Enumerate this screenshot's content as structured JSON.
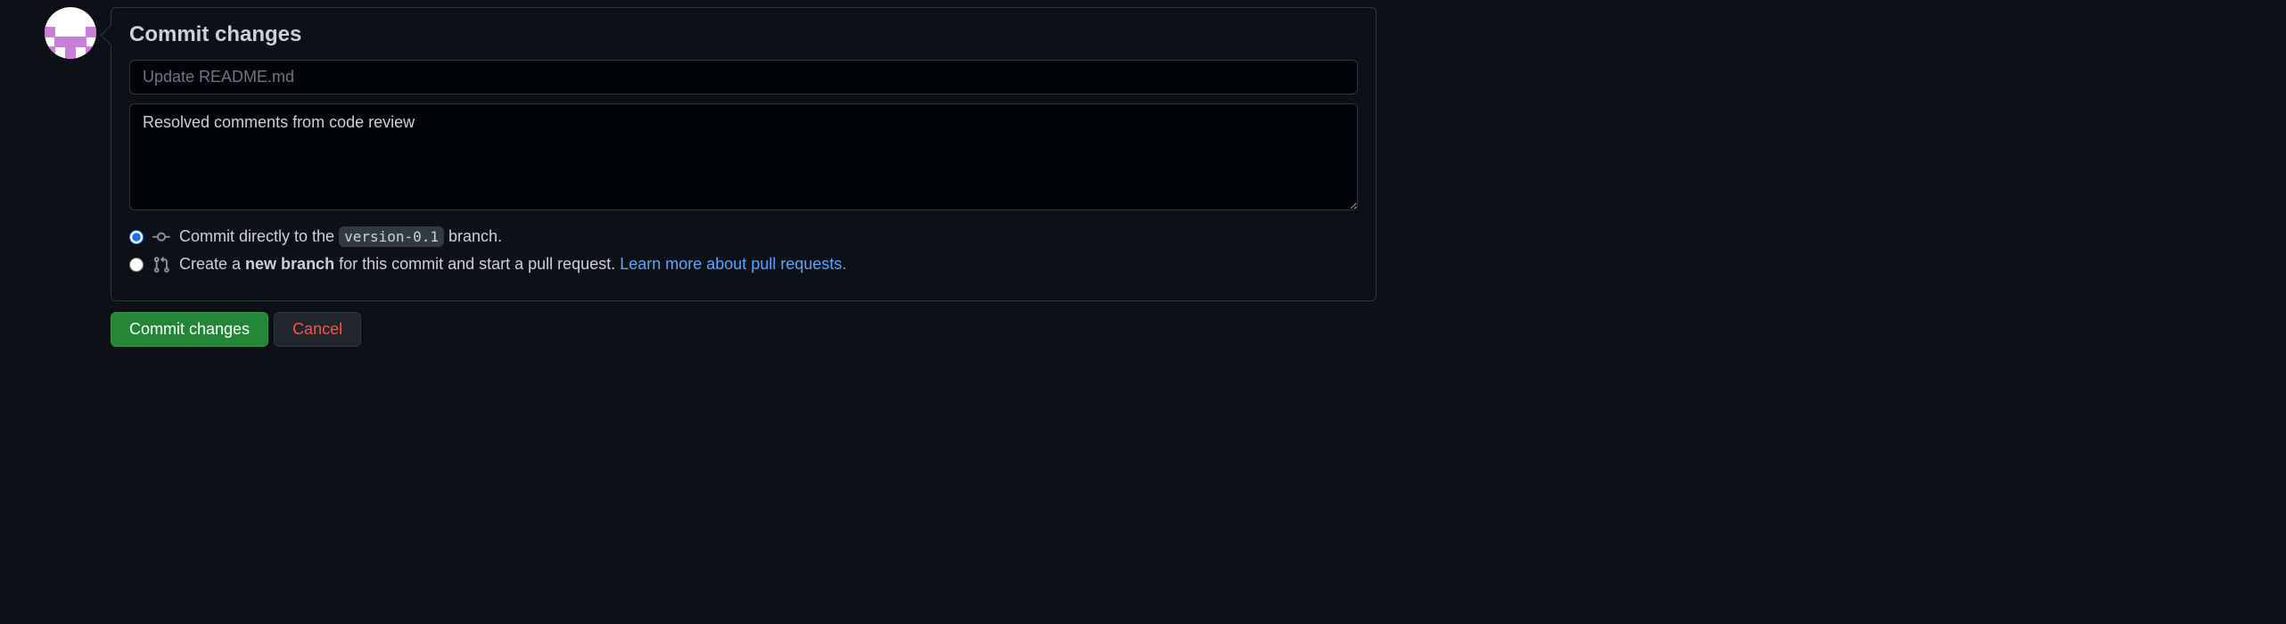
{
  "heading": "Commit changes",
  "summary_placeholder": "Update README.md",
  "summary_value": "",
  "description_value": "Resolved comments from code review",
  "options": {
    "direct": {
      "prefix": "Commit directly to the ",
      "branch": "version-0.1",
      "suffix": " branch."
    },
    "new_branch": {
      "prefix": "Create a ",
      "bold": "new branch",
      "suffix": " for this commit and start a pull request. ",
      "link": "Learn more about pull requests."
    }
  },
  "buttons": {
    "commit": "Commit changes",
    "cancel": "Cancel"
  }
}
